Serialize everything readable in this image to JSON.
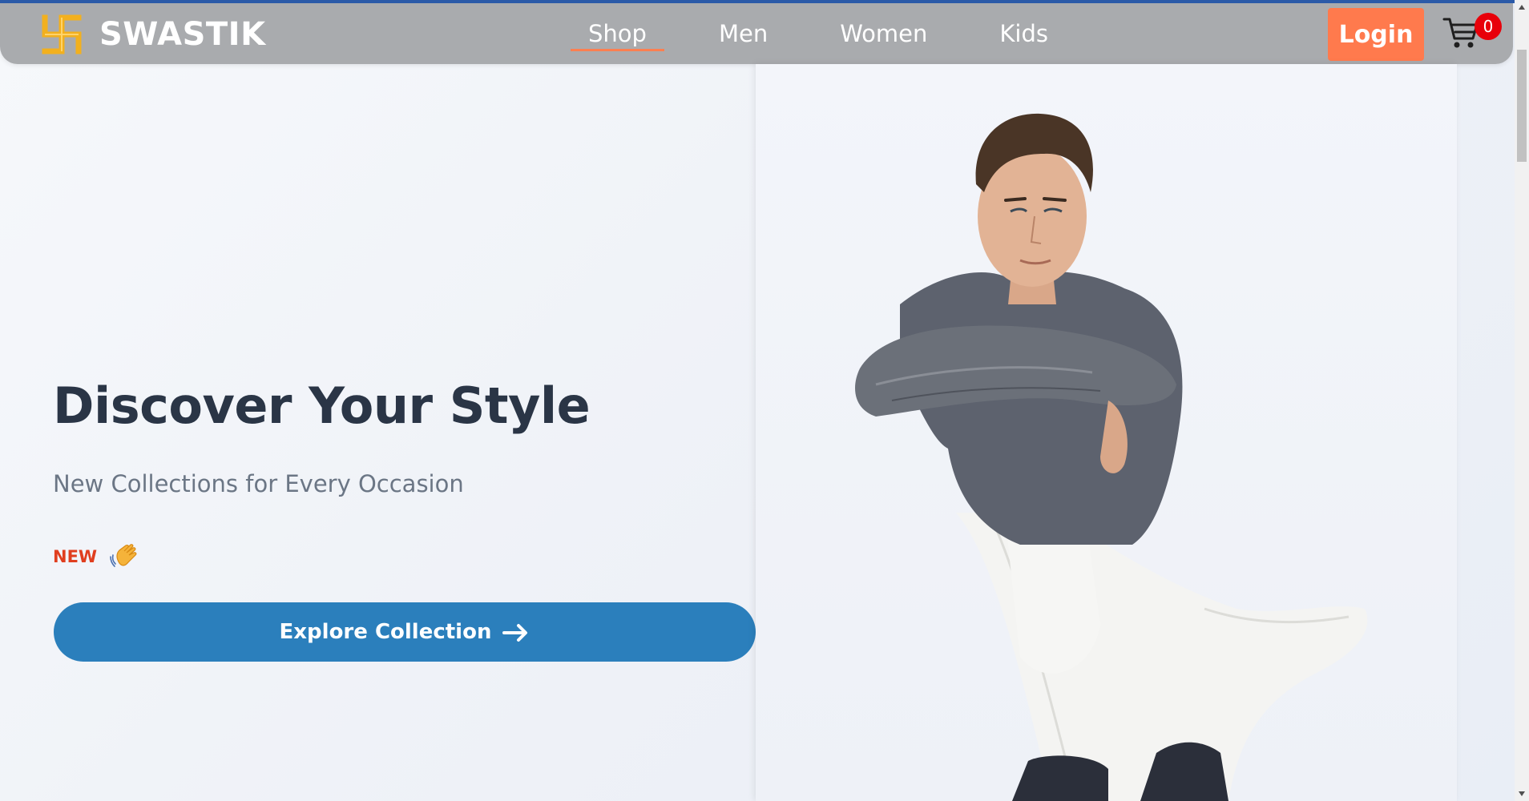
{
  "brand": {
    "name": "SWASTIK",
    "logo_icon": "swastik-logo-icon",
    "logo_color": "#f2b01e"
  },
  "nav": {
    "links": [
      {
        "label": "Shop",
        "active": true
      },
      {
        "label": "Men",
        "active": false
      },
      {
        "label": "Women",
        "active": false
      },
      {
        "label": "Kids",
        "active": false
      }
    ],
    "active_underline_color": "#ff7f50"
  },
  "header": {
    "login_label": "Login",
    "cart_count": "0",
    "cart_icon": "cart-icon"
  },
  "hero": {
    "title": "Discover Your Style",
    "subtitle": "New Collections for Every Occasion",
    "badge": "NEW",
    "badge_icon": "waving-hand-icon",
    "cta_label": "Explore Collection",
    "cta_icon": "arrow-right-icon",
    "image_alt": "male model in grey sweater and white trousers"
  },
  "colors": {
    "navbar": "#a9abae",
    "login": "#ff7a4d",
    "cta": "#2b7fbc",
    "badge": "#e03e1f",
    "cart_badge": "#e8000a"
  }
}
